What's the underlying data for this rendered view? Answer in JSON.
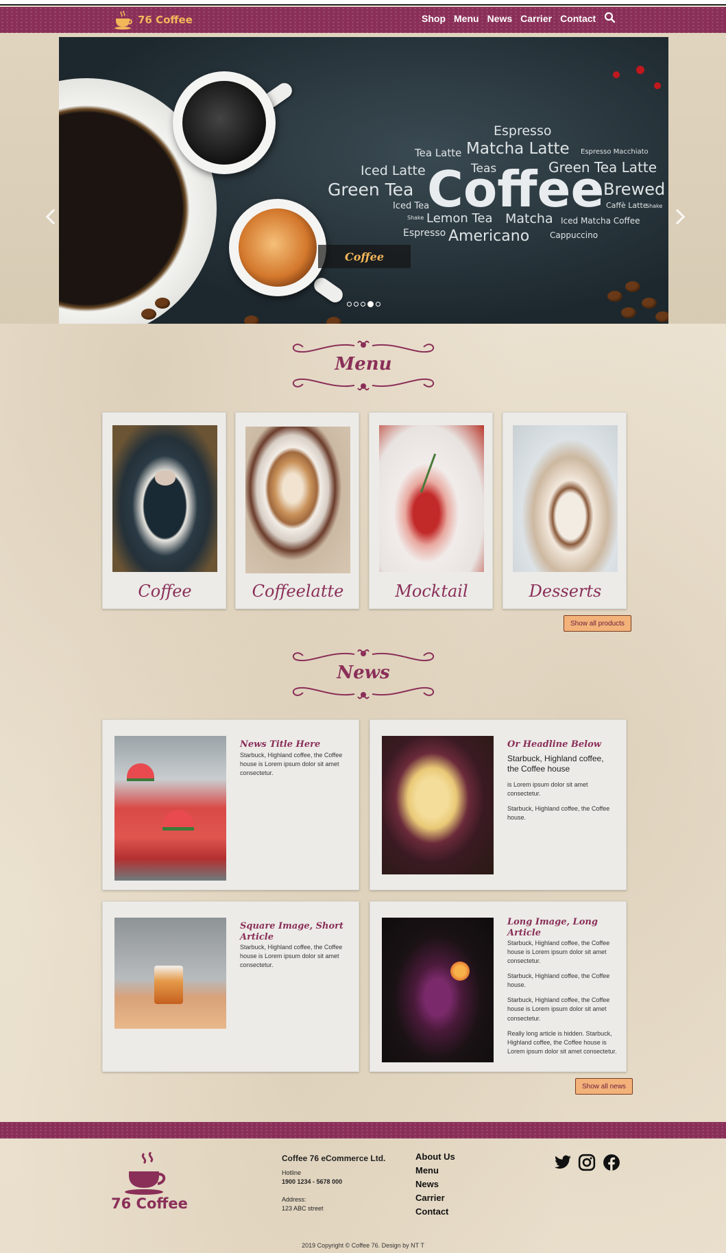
{
  "brand": {
    "name": "76 Coffee",
    "accent": "#8a2f58",
    "gold": "#f3b75a"
  },
  "nav": {
    "items": [
      "Shop",
      "Menu",
      "News",
      "Carrier",
      "Contact"
    ],
    "search_icon": "search-icon"
  },
  "hero": {
    "caption": "Coffee",
    "slides_count": 5,
    "active_slide": 4,
    "words": {
      "espresso": "Espresso",
      "tea_latte": "Tea Latte",
      "matcha_latte": "Matcha Latte",
      "espresso_macchiato": "Espresso Macchiato",
      "iced_latte": "Iced Latte",
      "teas": "Teas",
      "green_tea_latte": "Green Tea Latte",
      "green_tea": "Green Tea",
      "coffee": "Coffee",
      "brewed": "Brewed",
      "iced_tea": "Iced Tea",
      "caffe_latte": "Caffè Latte",
      "shake_right": "Shake",
      "shake_left": "Shake",
      "lemon_tea": "Lemon Tea",
      "matcha": "Matcha",
      "iced_matcha_coffee": "Iced Matcha Coffee",
      "espresso_2": "Espresso",
      "americano": "Americano",
      "cappuccino": "Cappuccino"
    }
  },
  "menu": {
    "heading": "Menu",
    "cards": [
      "Coffee",
      "Coffeelatte",
      "Mocktail",
      "Desserts"
    ],
    "show_all": "Show all products"
  },
  "news": {
    "heading": "News",
    "show_all": "Show all news",
    "articles": [
      {
        "title": "News Title Here",
        "paragraphs": [
          "Starbuck, Highland coffee, the Coffee house is Lorem ipsum dolor sit amet consectetur."
        ]
      },
      {
        "title": "Or Headline Below",
        "subtitle": "Starbuck, Highland coffee, the Coffee house",
        "paragraphs": [
          "is Lorem ipsum dolor sit amet consectetur.",
          "Starbuck, Highland coffee, the Coffee house."
        ]
      },
      {
        "title": "Square Image, Short Article",
        "paragraphs": [
          "Starbuck, Highland coffee, the Coffee house is Lorem ipsum dolor sit amet consectetur."
        ]
      },
      {
        "title": "Long Image, Long Article",
        "paragraphs": [
          "Starbuck, Highland coffee, the Coffee house is Lorem ipsum dolor sit amet consectetur.",
          "Starbuck, Highland coffee, the Coffee house.",
          "Starbuck, Highland coffee, the Coffee house is Lorem ipsum dolor sit amet consectetur.",
          "Really long article is hidden. Starbuck, Highland coffee, the Coffee house is Lorem ipsum dolor sit amet consectetur."
        ]
      }
    ]
  },
  "footer": {
    "logo_text": "76 Coffee",
    "company": "Coffee 76 eCommerce Ltd.",
    "hotline_label": "Hotline",
    "hotline": "1900 1234 - 5678 000",
    "address_label": "Address:",
    "address": "123 ABC street",
    "links": [
      "About Us",
      "Menu",
      "News",
      "Carrier",
      "Contact"
    ],
    "social": [
      "twitter-icon",
      "instagram-icon",
      "facebook-icon"
    ],
    "copyright": "2019 Copyright © Coffee 76. Design by NT T"
  }
}
